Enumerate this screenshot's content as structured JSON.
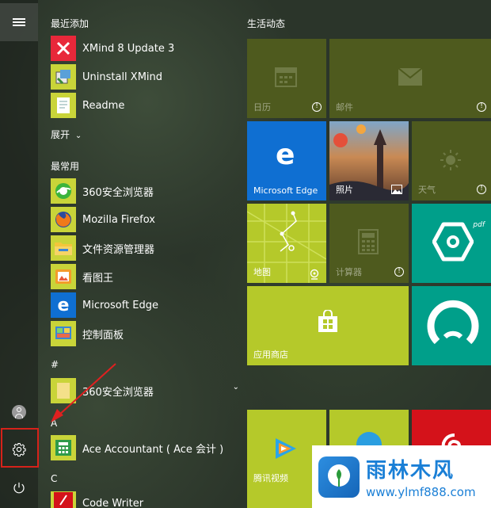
{
  "list": {
    "recent_header": "最近添加",
    "recent": [
      {
        "label": "XMind 8 Update 3",
        "icon": "xmind-icon",
        "bg": "#c9d439"
      },
      {
        "label": "Uninstall XMind",
        "icon": "uninstall-icon",
        "bg": "#c9d439"
      },
      {
        "label": "Readme",
        "icon": "document-icon",
        "bg": "#c9d439"
      }
    ],
    "expand_label": "展开",
    "frequent_header": "最常用",
    "frequent": [
      {
        "label": "360安全浏览器",
        "icon": "360-browser-icon",
        "bg": "#c9d439"
      },
      {
        "label": "Mozilla Firefox",
        "icon": "firefox-icon",
        "bg": "#c9d439"
      },
      {
        "label": "文件资源管理器",
        "icon": "folder-icon",
        "bg": "#c9d439"
      },
      {
        "label": "看图王",
        "icon": "image-viewer-icon",
        "bg": "#c9d439"
      },
      {
        "label": "Microsoft Edge",
        "icon": "edge-icon",
        "bg": "#0f6fd2"
      },
      {
        "label": "控制面板",
        "icon": "control-panel-icon",
        "bg": "#c9d439"
      }
    ],
    "hash_letter": "#",
    "hash_item": {
      "label": "360安全浏览器",
      "icon": "folder-yellow-icon",
      "bg": "#c9d439"
    },
    "letter_a": "A",
    "a_item": {
      "label": "Ace Accountant ( Ace 会计 )",
      "icon": "ace-icon",
      "bg": "#c9d439"
    },
    "letter_c": "C",
    "c_item": {
      "label": "Code Writer",
      "icon": "code-writer-icon",
      "bg": "#c9d439"
    }
  },
  "tiles": {
    "header": "生活动态",
    "calendar": "日历",
    "mail": "邮件",
    "edge": "Microsoft Edge",
    "photos": "照片",
    "weather": "天气",
    "maps": "地图",
    "calculator": "计算器",
    "store": "应用商店",
    "tencent_video": "腾讯视频"
  },
  "watermark": {
    "name": "雨林木风",
    "url": "www.ylmf888.com"
  },
  "colors": {
    "lime": "#b5c92a",
    "lime_dim": "#4e5a1e",
    "blue": "#0f6fd2",
    "teal": "#009f8a",
    "red": "#d4121a"
  }
}
